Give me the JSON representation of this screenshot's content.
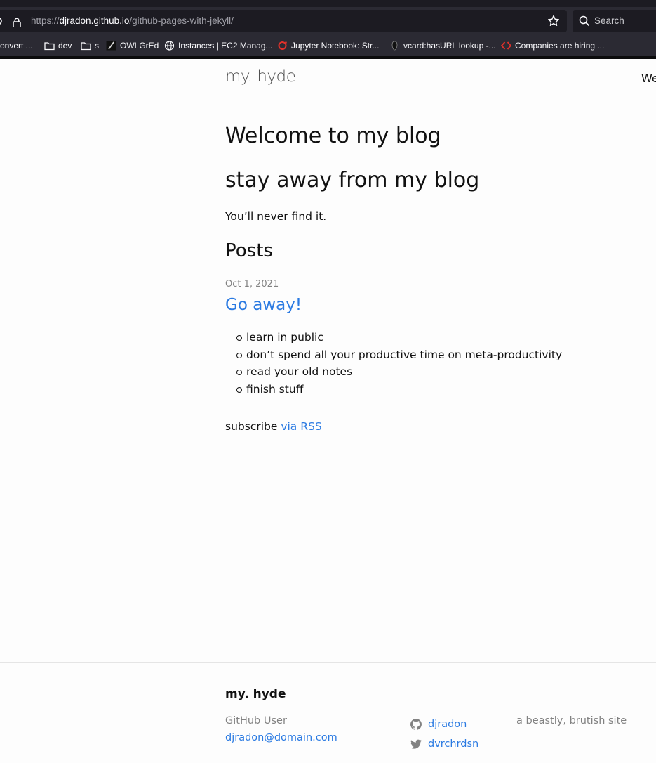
{
  "browser": {
    "url_scheme": "https://",
    "url_host": "djradon.github.io",
    "url_path": "/github-pages-with-jekyll/",
    "search_placeholder": "Search",
    "bookmarks": [
      {
        "label": "onvert ...",
        "icon": "page-icon"
      },
      {
        "label": "dev",
        "icon": "folder-icon"
      },
      {
        "label": "s",
        "icon": "folder-icon"
      },
      {
        "label": "OWLGrEd",
        "icon": "owlgred-icon"
      },
      {
        "label": "Instances | EC2 Manag...",
        "icon": "globe-icon"
      },
      {
        "label": "Jupyter Notebook: Str...",
        "icon": "jupyter-icon"
      },
      {
        "label": "vcard:hasURL lookup -...",
        "icon": "vcard-icon"
      },
      {
        "label": "Companies are hiring ...",
        "icon": "code-icon"
      }
    ]
  },
  "header": {
    "site_title": "my. hyde",
    "nav_link": "We"
  },
  "main": {
    "heading1": "Welcome to my blog",
    "heading2": "stay away from my blog",
    "tagline": "You’ll never find it.",
    "posts_heading": "Posts",
    "post": {
      "date": "Oct 1, 2021",
      "title": "Go away!",
      "items": [
        "learn in public",
        "don’t spend all your productive time on meta-productivity",
        "read your old notes",
        "finish stuff"
      ]
    },
    "subscribe_text": "subscribe ",
    "subscribe_link": "via RSS"
  },
  "footer": {
    "title": "my. hyde",
    "name": "GitHub User",
    "email": "djradon@domain.com",
    "github_user": "djradon",
    "twitter_user": "dvrchrdsn",
    "description": "a beastly, brutish site"
  },
  "colors": {
    "link": "#2a7ae2",
    "meta_gray": "#828282",
    "chrome_bg": "#2b2a33"
  }
}
